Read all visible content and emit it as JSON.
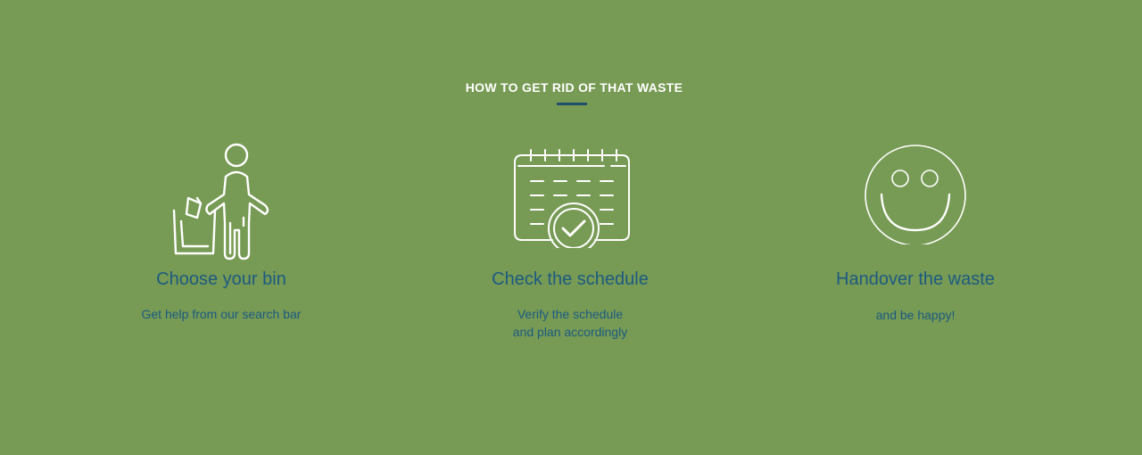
{
  "section": {
    "title": "HOW TO GET RID OF THAT WASTE",
    "colors": {
      "background": "#779b54",
      "heading": "#1d5a82",
      "underline": "#1e4f6b",
      "icon_stroke": "#ffffff"
    }
  },
  "steps": [
    {
      "icon": "person-trash-bin-icon",
      "heading": "Choose your bin",
      "description_lines": [
        "Get help from our search bar"
      ]
    },
    {
      "icon": "calendar-check-icon",
      "heading": "Check the schedule",
      "description_lines": [
        "Verify the schedule",
        "and plan accordingly"
      ]
    },
    {
      "icon": "smiley-face-icon",
      "heading": "Handover the waste",
      "description_lines": [
        "and be happy!"
      ]
    }
  ]
}
